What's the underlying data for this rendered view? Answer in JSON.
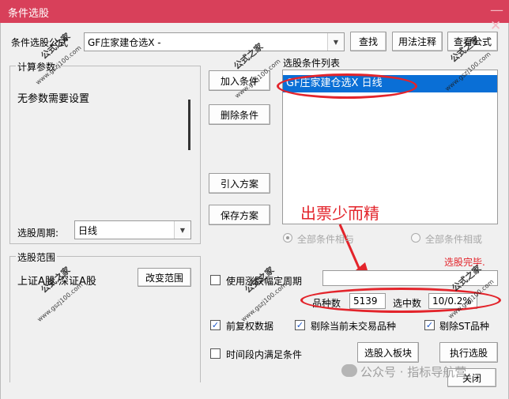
{
  "window": {
    "title": "条件选股",
    "close_glyph": "—  ✕"
  },
  "formula": {
    "label": "条件选股公式",
    "value": "GF庄家建仓选X  -",
    "find_button": "查找",
    "usage_button": "用法注释",
    "view_button": "查看公式"
  },
  "params": {
    "group_label": "计算参数",
    "no_params_text": "无参数需要设置"
  },
  "period": {
    "label": "选股周期:",
    "value": "日线"
  },
  "actions": {
    "add": "加入条件",
    "delete": "删除条件",
    "import": "引入方案",
    "save": "保存方案"
  },
  "conditions": {
    "label": "选股条件列表",
    "items": [
      "GF庄家建仓选X  日线"
    ]
  },
  "annotation": {
    "text": "出票少而精"
  },
  "logic": {
    "and_label": "全部条件相与",
    "or_label": "全部条件相或"
  },
  "status": {
    "done_text": "选股完毕.",
    "count_label": "品种数",
    "count_value": "5139",
    "selected_label": "选中数",
    "selected_value": "10/0.2%"
  },
  "range": {
    "group_label": "选股范围",
    "value": "上证A股 深证A股",
    "change_button": "改变范围"
  },
  "options": {
    "use_rise_period": "使用涨跌幅定周期",
    "adjusted_data": "前复权数据",
    "exclude_untraded": "剔除当前未交易品种",
    "exclude_st": "剔除ST品种",
    "period_satisfy": "时间段内满足条件"
  },
  "buttons": {
    "to_block": "选股入板块",
    "execute": "执行选股",
    "close": "关闭"
  },
  "watermark": {
    "title": "公式之家",
    "url": "www.gszj100.com"
  },
  "footer": {
    "source": "公众号 · 指标导航营"
  }
}
